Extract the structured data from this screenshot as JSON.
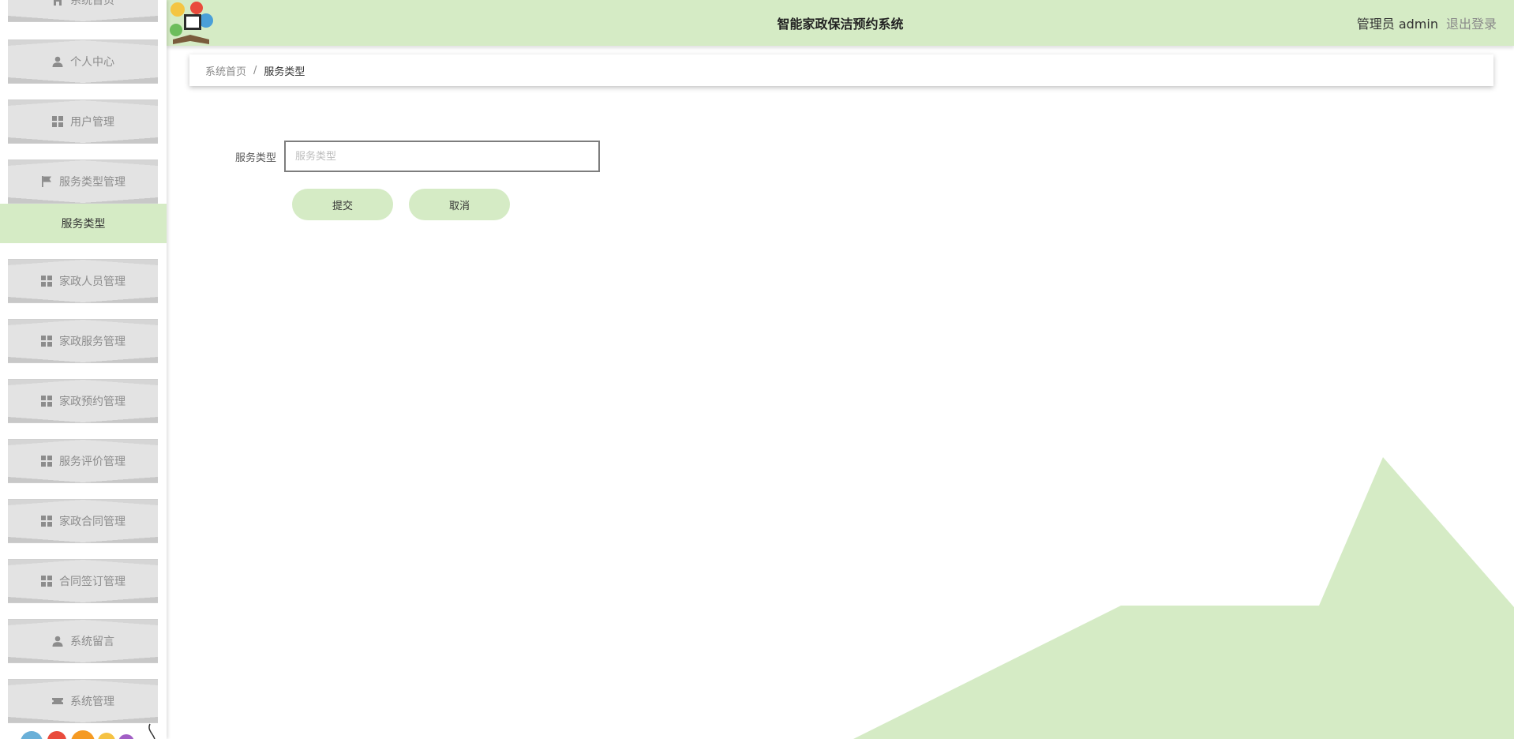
{
  "app": {
    "title": "智能家政保洁预约系统"
  },
  "header": {
    "user_label": "管理员 admin",
    "logout_label": "退出登录"
  },
  "sidebar": {
    "items": [
      {
        "label": "系统首页",
        "icon": "home-icon"
      },
      {
        "label": "个人中心",
        "icon": "user-icon"
      },
      {
        "label": "用户管理",
        "icon": "grid-icon"
      },
      {
        "label": "服务类型管理",
        "icon": "flag-icon"
      },
      {
        "label": "家政人员管理",
        "icon": "grid-icon"
      },
      {
        "label": "家政服务管理",
        "icon": "grid-icon"
      },
      {
        "label": "家政预约管理",
        "icon": "grid-icon"
      },
      {
        "label": "服务评价管理",
        "icon": "grid-icon"
      },
      {
        "label": "家政合同管理",
        "icon": "grid-icon"
      },
      {
        "label": "合同签订管理",
        "icon": "grid-icon"
      },
      {
        "label": "系统留言",
        "icon": "user-icon"
      },
      {
        "label": "系统管理",
        "icon": "ticket-icon"
      }
    ],
    "active_subitem": "服务类型"
  },
  "breadcrumb": {
    "home": "系统首页",
    "separator": "/",
    "current": "服务类型"
  },
  "form": {
    "field_label": "服务类型",
    "field_placeholder": "服务类型",
    "field_value": "",
    "submit_label": "提交",
    "cancel_label": "取消"
  },
  "colors": {
    "accent": "#d5ebc5",
    "menu_bg": "#e3e3e3",
    "menu_text": "#8c8c8c"
  }
}
